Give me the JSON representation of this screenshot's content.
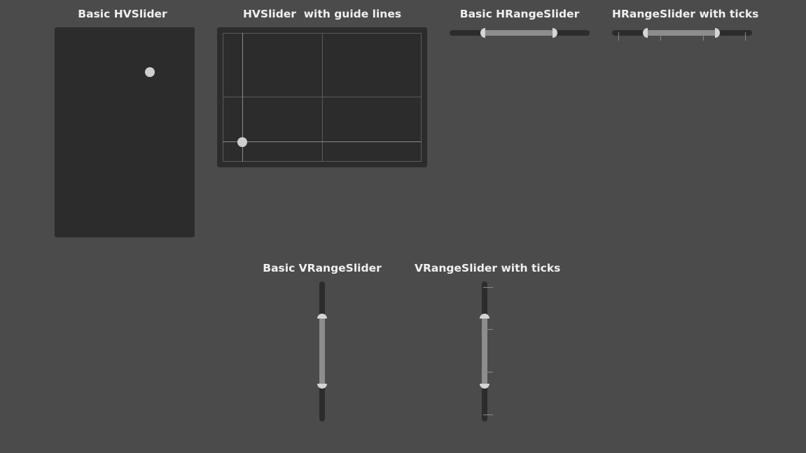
{
  "hvslider_basic": {
    "title": "Basic HVSlider",
    "value_x": 0.68,
    "value_y": 0.8
  },
  "hvslider_guides": {
    "title": "HVSlider  with guide lines",
    "value_x": 0.1,
    "value_y": 0.15
  },
  "hrange_basic": {
    "title": "Basic HRangeSlider",
    "low": 0.25,
    "high": 0.75
  },
  "hrange_ticks": {
    "title": "HRangeSlider with ticks",
    "low": 0.25,
    "high": 0.75
  },
  "vrange_basic": {
    "title": "Basic VRangeSlider",
    "low": 0.25,
    "high": 0.75
  },
  "vrange_ticks": {
    "title": "VRangeSlider with ticks",
    "low": 0.25,
    "high": 0.75
  },
  "colors": {
    "background": "#4b4b4b",
    "panel": "#2c2c2c",
    "handle": "#d4d4d4",
    "fill": "#8d8d8d"
  }
}
